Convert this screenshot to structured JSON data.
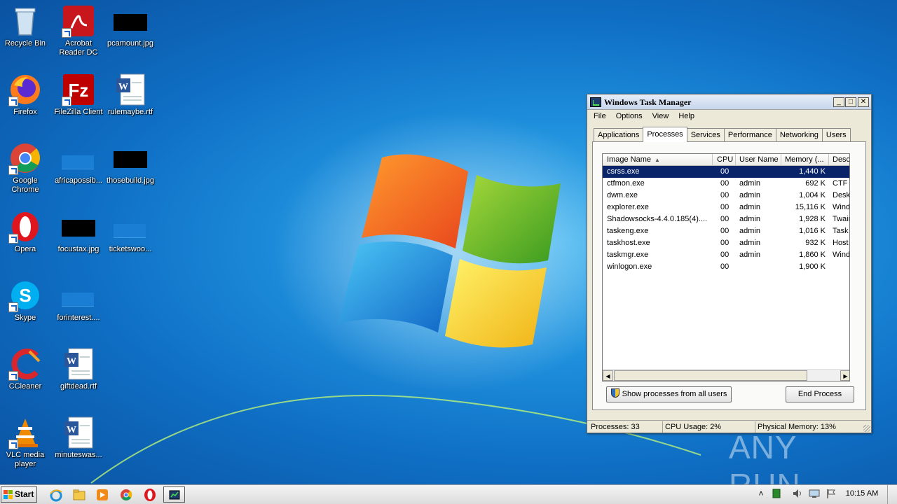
{
  "desktop": {
    "icons": [
      {
        "label": "Recycle Bin",
        "icon": "recycle-bin-icon"
      },
      {
        "label": "Acrobat\nReader DC",
        "icon": "acrobat-icon"
      },
      {
        "label": "pcamount.jpg",
        "icon": "image-file-icon"
      },
      {
        "label": "Firefox",
        "icon": "firefox-icon"
      },
      {
        "label": "FileZilla Client",
        "icon": "filezilla-icon"
      },
      {
        "label": "rulemaybe.rtf",
        "icon": "word-document-icon"
      },
      {
        "label": "Google\nChrome",
        "icon": "chrome-icon"
      },
      {
        "label": "africapossib...",
        "icon": "file-icon"
      },
      {
        "label": "thosebuild.jpg",
        "icon": "image-file-icon"
      },
      {
        "label": "Opera",
        "icon": "opera-icon"
      },
      {
        "label": "focustax.jpg",
        "icon": "image-file-icon"
      },
      {
        "label": "ticketswoo...",
        "icon": "file-icon"
      },
      {
        "label": "Skype",
        "icon": "skype-icon"
      },
      {
        "label": "forinterest....",
        "icon": "file-icon"
      },
      {
        "label": "CCleaner",
        "icon": "ccleaner-icon"
      },
      {
        "label": "giftdead.rtf",
        "icon": "word-document-icon"
      },
      {
        "label": "VLC media\nplayer",
        "icon": "vlc-icon"
      },
      {
        "label": "minuteswas...",
        "icon": "word-document-icon"
      }
    ]
  },
  "task_manager": {
    "title": "Windows Task Manager",
    "window_buttons": {
      "minimize": "_",
      "maximize": "□",
      "close": "✕"
    },
    "menu": [
      "File",
      "Options",
      "View",
      "Help"
    ],
    "tabs": [
      "Applications",
      "Processes",
      "Services",
      "Performance",
      "Networking",
      "Users"
    ],
    "active_tab": "Processes",
    "columns": [
      "Image Name",
      "CPU",
      "User Name",
      "Memory (...",
      "Desc"
    ],
    "sort_indicator": "▲",
    "rows": [
      {
        "name": "csrss.exe",
        "cpu": "00",
        "user": "",
        "memory": "1,440 K",
        "desc": "",
        "selected": true
      },
      {
        "name": "ctfmon.exe",
        "cpu": "00",
        "user": "admin",
        "memory": "692 K",
        "desc": "CTF I"
      },
      {
        "name": "dwm.exe",
        "cpu": "00",
        "user": "admin",
        "memory": "1,004 K",
        "desc": "Desk"
      },
      {
        "name": "explorer.exe",
        "cpu": "00",
        "user": "admin",
        "memory": "15,116 K",
        "desc": "Wind"
      },
      {
        "name": "Shadowsocks-4.4.0.185(4)....",
        "cpu": "00",
        "user": "admin",
        "memory": "1,928 K",
        "desc": "Twair"
      },
      {
        "name": "taskeng.exe",
        "cpu": "00",
        "user": "admin",
        "memory": "1,016 K",
        "desc": "Task"
      },
      {
        "name": "taskhost.exe",
        "cpu": "00",
        "user": "admin",
        "memory": "932 K",
        "desc": "Host"
      },
      {
        "name": "taskmgr.exe",
        "cpu": "00",
        "user": "admin",
        "memory": "1,860 K",
        "desc": "Wind"
      },
      {
        "name": "winlogon.exe",
        "cpu": "00",
        "user": "",
        "memory": "1,900 K",
        "desc": ""
      }
    ],
    "show_all_button": "Show processes from all users",
    "end_process_button": "End Process",
    "status": {
      "processes": "Processes: 33",
      "cpu": "CPU Usage: 2%",
      "memory": "Physical Memory: 13%"
    }
  },
  "watermark": "ANY RUN",
  "taskbar": {
    "start_label": "Start",
    "pinned": [
      "internet-explorer-icon",
      "file-explorer-icon",
      "media-player-icon",
      "chrome-icon",
      "opera-icon"
    ],
    "active_app": "task-manager-icon",
    "clock": "10:15 AM"
  }
}
